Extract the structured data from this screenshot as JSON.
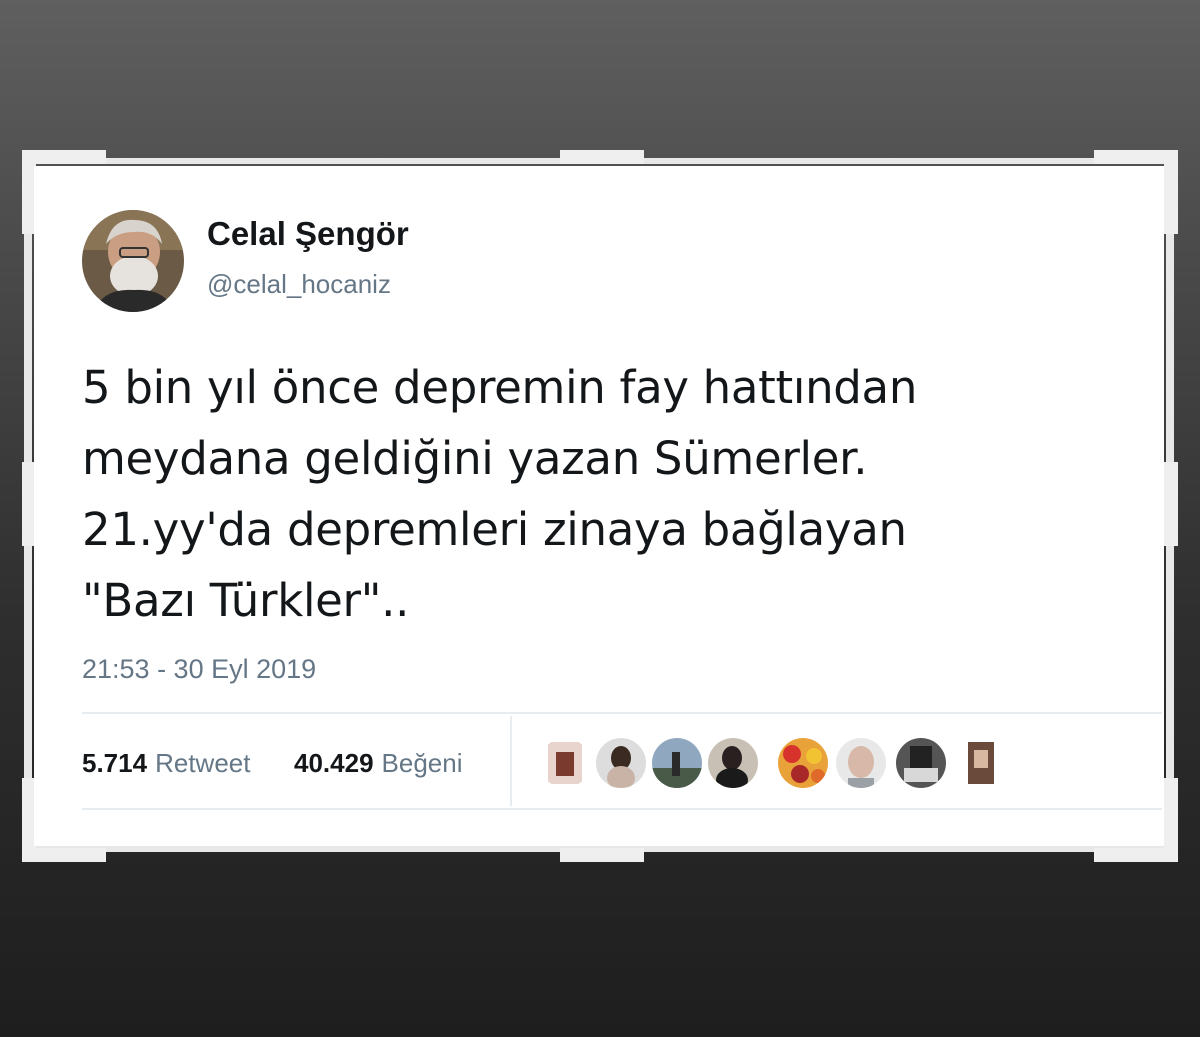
{
  "tweet": {
    "author_name": "Celal Şengör",
    "author_handle": "@celal_hocaniz",
    "text_lines": [
      "5 bin yıl önce depremin fay hattından",
      "meydana geldiğini yazan Sümerler.",
      "21.yy'da depremleri zinaya bağlayan",
      "\"Bazı Türkler\".."
    ],
    "timestamp": "21:53 - 30 Eyl 2019",
    "retweets_count": "5.714",
    "retweets_label": "Retweet",
    "likes_count": "40.429",
    "likes_label": "Beğeni",
    "likers_shown": 8
  },
  "colors": {
    "text_primary": "#14171a",
    "text_secondary": "#657786",
    "divider": "#e6ecf0",
    "card_bg": "#ffffff"
  }
}
